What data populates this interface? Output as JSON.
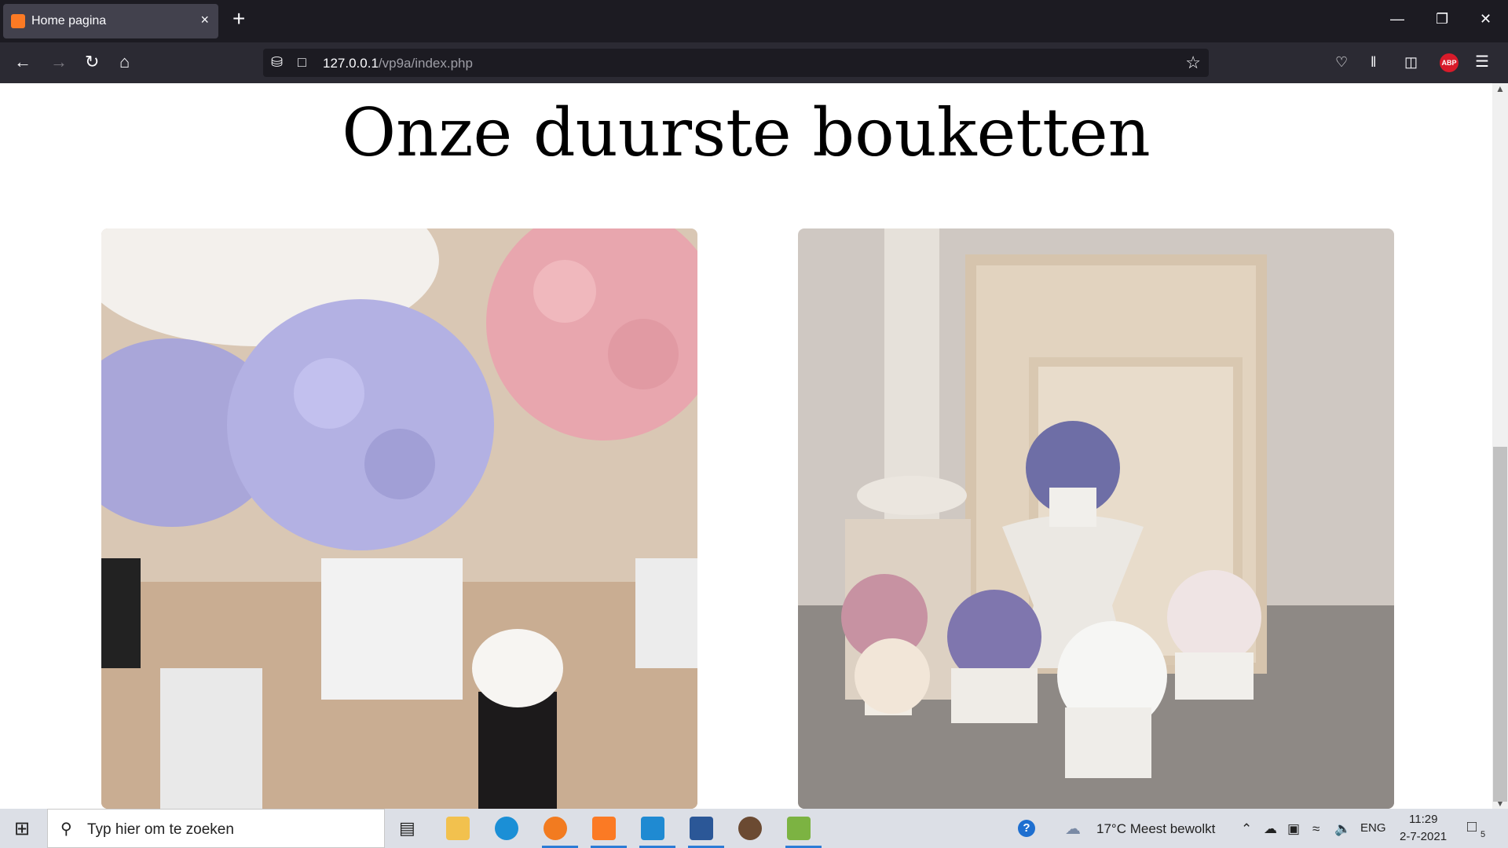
{
  "browser": {
    "tab_title": "Home pagina",
    "tab_close": "×",
    "new_tab": "+",
    "url_host": "127.0.0.1",
    "url_path": "/vp9a/index.php",
    "abp_label": "ABP"
  },
  "page": {
    "heading": "Onze duurste bouketten"
  },
  "taskbar": {
    "search_placeholder": "Typ hier om te zoeken",
    "weather": "17°C  Meest bewolkt",
    "language": "ENG",
    "time": "11:29",
    "date": "2-7-2021",
    "notification_count": "5"
  },
  "colors": {
    "tab_bg": "#42414d",
    "strip_bg": "#1c1b22",
    "navbar_bg": "#2b2a33",
    "abp_red": "#d81b2a",
    "xampp_orange": "#fb7a24"
  }
}
